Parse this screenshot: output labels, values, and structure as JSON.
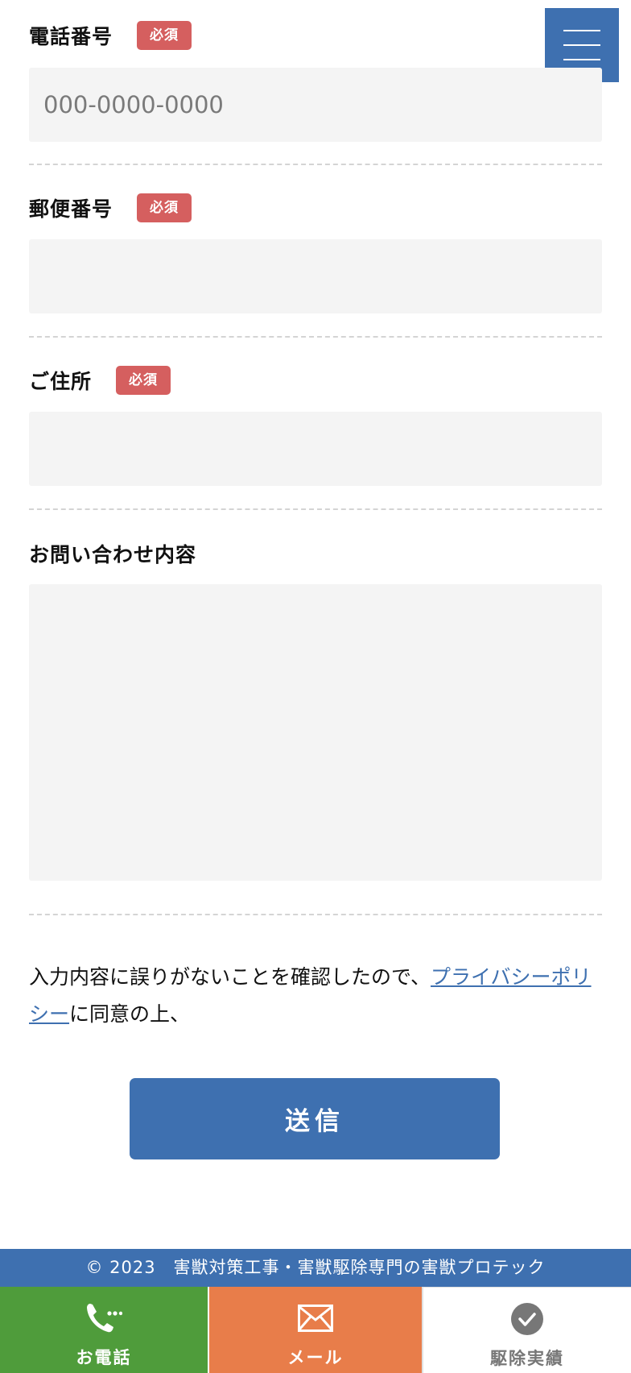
{
  "header": {
    "menu_icon": "hamburger-icon"
  },
  "form": {
    "required_badge": "必須",
    "phone": {
      "label": "電話番号",
      "placeholder": "000-0000-0000",
      "value": ""
    },
    "postal": {
      "label": "郵便番号",
      "placeholder": "",
      "value": ""
    },
    "address": {
      "label": "ご住所",
      "placeholder": "",
      "value": ""
    },
    "inquiry": {
      "label": "お問い合わせ内容",
      "placeholder": "",
      "value": ""
    },
    "consent": {
      "before": "入力内容に誤りがないことを確認したので、",
      "link": "プライバシーポリシー",
      "after": "に同意の上、"
    },
    "submit_label": "送信"
  },
  "footer": {
    "copyright": "© 2023　害獣対策工事・害獣駆除専門の害獣プロテック"
  },
  "bottom_nav": {
    "phone": {
      "label": "お電話",
      "icon": "phone-icon"
    },
    "mail": {
      "label": "メール",
      "icon": "mail-icon"
    },
    "results": {
      "label": "駆除実績",
      "icon": "check-circle-icon"
    }
  },
  "colors": {
    "primary": "#3e70b0",
    "required": "#d55f5f",
    "phone_bg": "#4f9c3b",
    "mail_bg": "#e87d4a",
    "field_bg": "#f4f4f4"
  }
}
